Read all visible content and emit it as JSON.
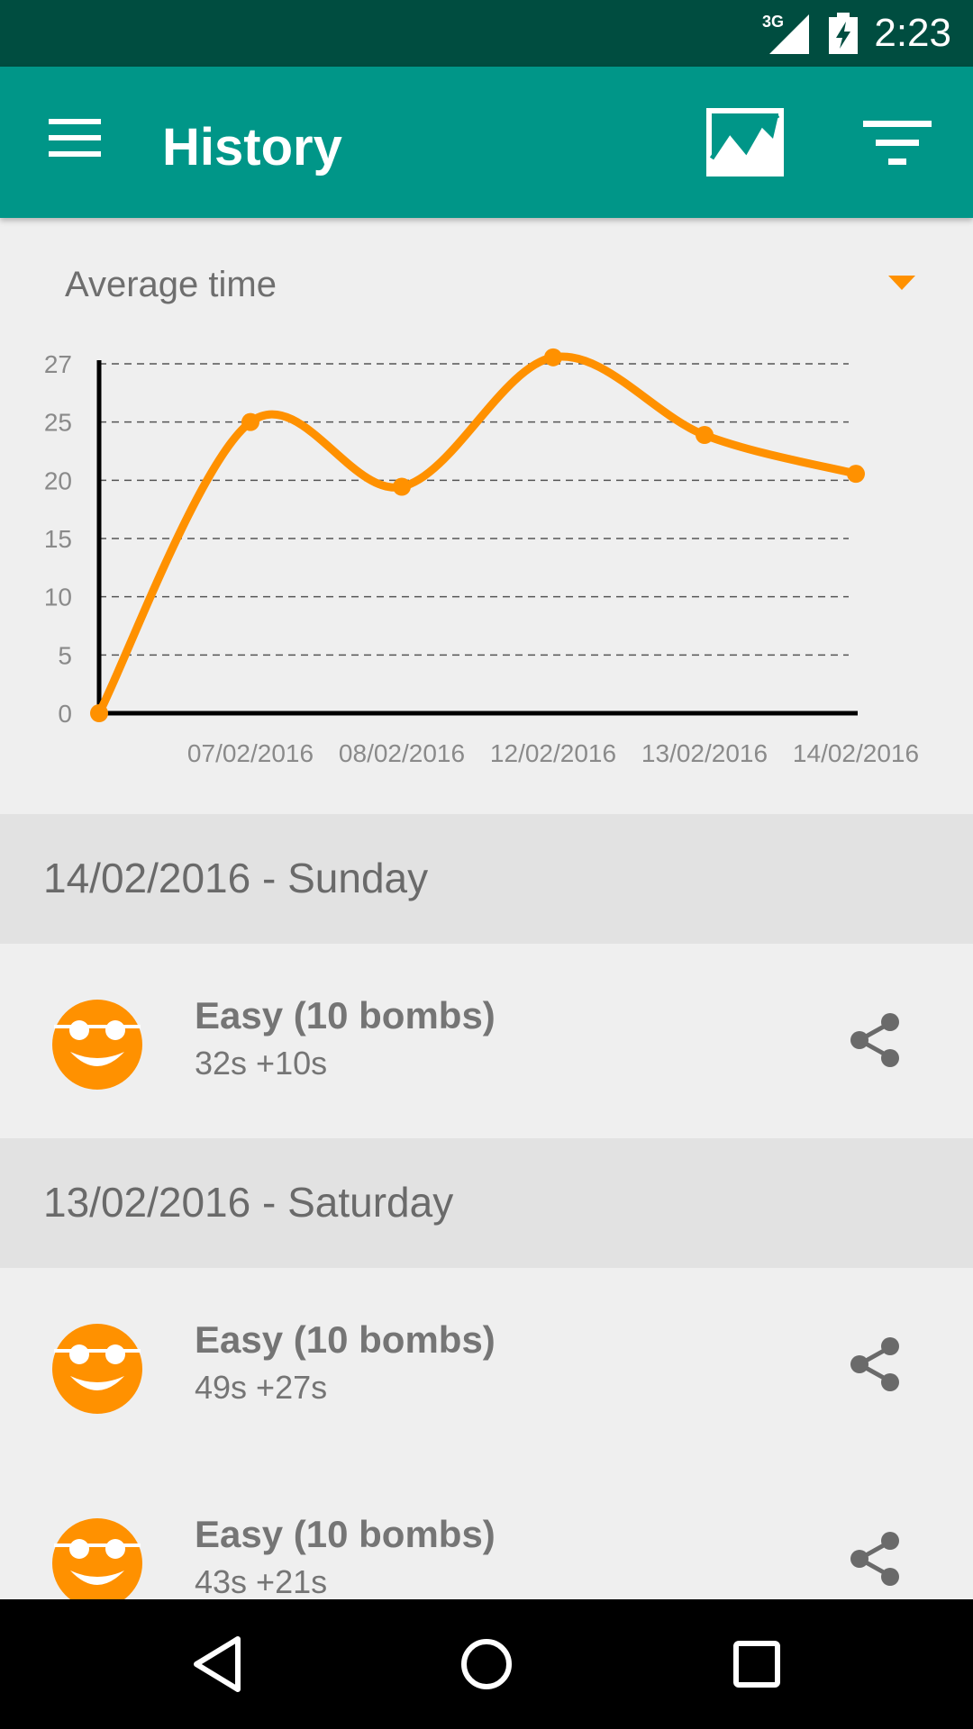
{
  "status_bar": {
    "time": "2:23",
    "network": "3G",
    "network_icon": "signal-icon",
    "battery_icon": "battery-charging-icon"
  },
  "app_bar": {
    "title": "History",
    "menu_icon": "menu-icon",
    "chart_icon": "line-chart-icon",
    "filter_icon": "filter-icon",
    "background": "#009688"
  },
  "stat_selector": {
    "selected": "Average time"
  },
  "chart_data": {
    "type": "line",
    "x": [
      "",
      "07/02/2016",
      "08/02/2016",
      "12/02/2016",
      "13/02/2016",
      "14/02/2016"
    ],
    "y_ticks": [
      "0",
      "5",
      "10",
      "15",
      "20",
      "25",
      "27"
    ],
    "series": [
      {
        "values": [
          0,
          22.5,
          17.5,
          27.5,
          21.5,
          18.5
        ]
      }
    ],
    "ylim": [
      0,
      27
    ],
    "grid": "horizontal dashed",
    "color": "#ff9100",
    "xlabel": "",
    "ylabel": ""
  },
  "history": [
    {
      "date": "14/02/2016 - Sunday",
      "games": [
        {
          "mode": "Easy (10 bombs)",
          "score": "32s +10s"
        }
      ]
    },
    {
      "date": "13/02/2016 - Saturday",
      "games": [
        {
          "mode": "Easy (10 bombs)",
          "score": "49s +27s"
        },
        {
          "mode": "Easy (10 bombs)",
          "score": "43s +21s"
        }
      ]
    }
  ],
  "icons": {
    "face": "smiley-sunglasses-icon",
    "share": "share-icon"
  },
  "nav_bar": {
    "back": "back-icon",
    "home": "home-icon",
    "recents": "recents-icon"
  }
}
